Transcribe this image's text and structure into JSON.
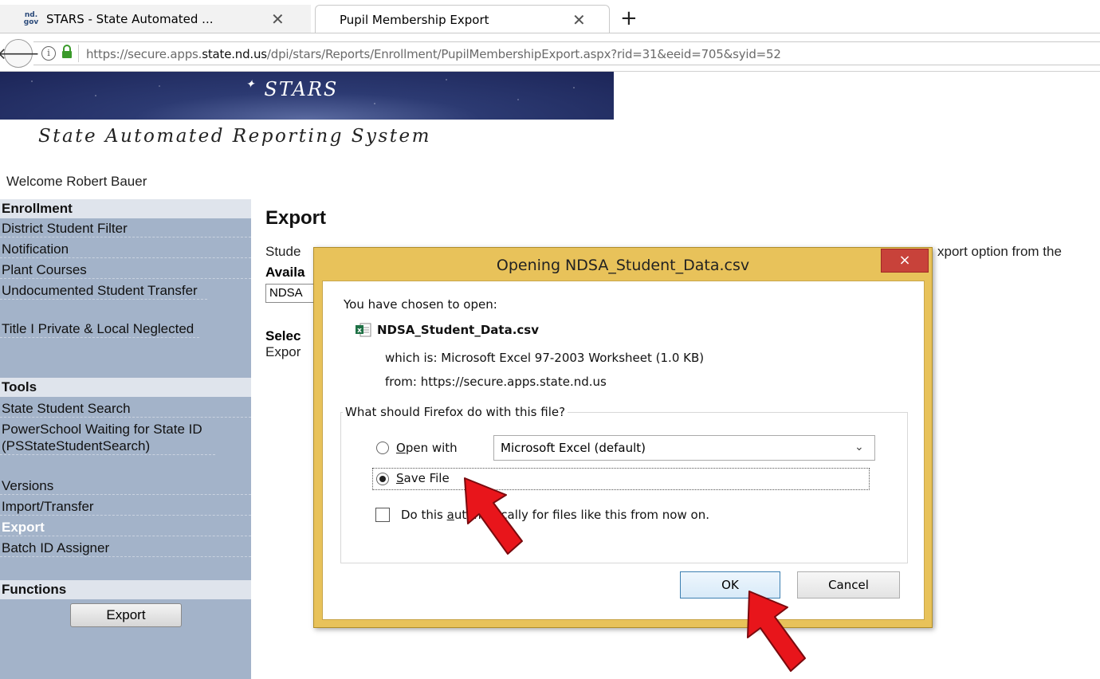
{
  "browser": {
    "tabs": [
      {
        "favicon": "nd. gov",
        "label": "STARS - State Automated ..."
      },
      {
        "label": "Pupil Membership Export"
      }
    ],
    "url_prefix": "https://secure.apps.",
    "url_domain": "state.nd.us",
    "url_suffix": "/dpi/stars/Reports/Enrollment/PupilMembershipExport.aspx?rid=31&eeid=705&syid=52"
  },
  "banner": {
    "title": "STARS",
    "subtitle": "State Automated Reporting System"
  },
  "welcome": "Welcome Robert Bauer",
  "sidebar": {
    "enrollment_head": "Enrollment",
    "enrollment_items": [
      "District Student Filter",
      "Notification",
      "Plant Courses",
      "Undocumented Student Transfer",
      "Title I Private & Local Neglected"
    ],
    "tools_head": "Tools",
    "tools_items": [
      "State Student Search",
      "PowerSchool Waiting for State ID (PSStateStudentSearch)",
      "Versions",
      "Import/Transfer",
      "Export",
      "Batch ID Assigner"
    ],
    "active_item": "Export",
    "functions_head": "Functions",
    "export_button": "Export"
  },
  "main": {
    "heading": "Export",
    "desc_start": "Stude",
    "desc_end": "xport option from the",
    "avail_label": "Availa",
    "avail_value": "NDSA",
    "select_label": "Selec",
    "export_label": "Expor"
  },
  "dialog": {
    "title": "Opening NDSA_Student_Data.csv",
    "close": "×",
    "chosen": "You have chosen to open:",
    "filename": "NDSA_Student_Data.csv",
    "which_is": "which is:  Microsoft Excel 97-2003 Worksheet (1.0 KB)",
    "from": "from:  https://secure.apps.state.nd.us",
    "question": "What should Firefox do with this file?",
    "open_with_rest": "pen with",
    "open_with_key": "O",
    "app_select": "Microsoft Excel (default)",
    "save_key": "S",
    "save_rest": "ave File",
    "auto_pre": "Do this ",
    "auto_key": "a",
    "auto_rest": "utomatically for files like this from now on.",
    "selected_option": "save",
    "checkbox_checked": false,
    "ok": "OK",
    "cancel": "Cancel"
  },
  "colors": {
    "sidebar_bg": "#a3b3c9",
    "dialog_frame": "#e8c25a",
    "close_button": "#c8423a",
    "annotation_arrow": "#e8151b"
  }
}
